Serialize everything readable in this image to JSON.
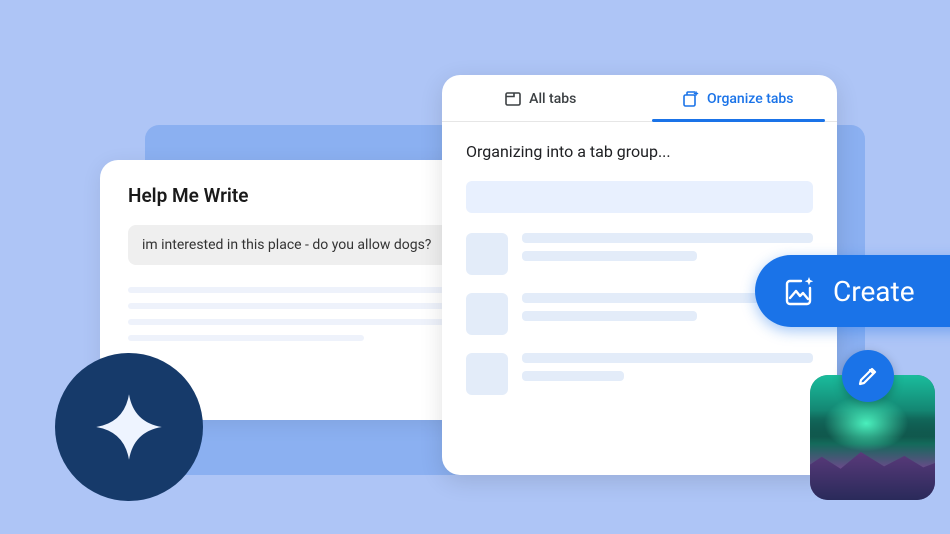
{
  "help_me_write": {
    "title": "Help Me Write",
    "input_text": "im interested in this place - do you allow dogs?"
  },
  "tab_organizer": {
    "tab_all": "All tabs",
    "tab_organize": "Organize tabs",
    "status": "Organizing into a tab group..."
  },
  "create_button": {
    "label": "Create"
  },
  "icons": {
    "spark": "spark-icon",
    "tab_box": "tab-box-icon",
    "organize": "organize-icon",
    "image_spark": "image-spark-icon",
    "pencil": "pencil-icon"
  },
  "colors": {
    "background": "#aec5f6",
    "accent": "#1a73e8",
    "dark_circle": "#163a6a"
  }
}
